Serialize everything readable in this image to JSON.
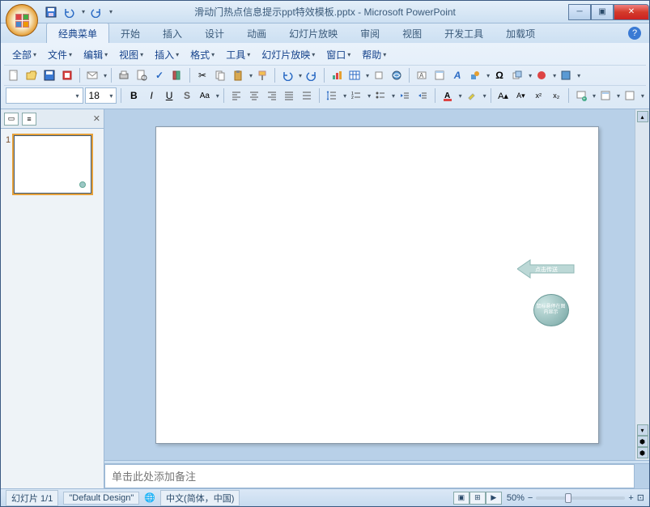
{
  "title": {
    "doc": "滑动门热点信息提示ppt特效模板.pptx",
    "app": "Microsoft PowerPoint"
  },
  "qat": {
    "save": "save-icon",
    "undo": "undo-icon",
    "redo": "redo-icon"
  },
  "tabs": [
    "经典菜单",
    "开始",
    "插入",
    "设计",
    "动画",
    "幻灯片放映",
    "审阅",
    "视图",
    "开发工具",
    "加载项"
  ],
  "activeTab": 0,
  "menus": [
    "全部",
    "文件",
    "编辑",
    "视图",
    "插入",
    "格式",
    "工具",
    "幻灯片放映",
    "窗口",
    "帮助"
  ],
  "font": {
    "name": "",
    "size": "18"
  },
  "fmt": {
    "B": "B",
    "I": "I",
    "U": "U",
    "S": "S",
    "Aa": "Aa"
  },
  "slideN": "1",
  "slideObjects": {
    "arrow": "点击传送",
    "circle": "鼠标悬停在图内显示"
  },
  "notesPlaceholder": "单击此处添加备注",
  "status": {
    "slide": "幻灯片 1/1",
    "design": "\"Default Design\"",
    "lang": "中文(简体，中国)",
    "zoom": "50%"
  },
  "colors": {
    "accent": "#e6a13a",
    "chrome": "#cde0f2"
  }
}
